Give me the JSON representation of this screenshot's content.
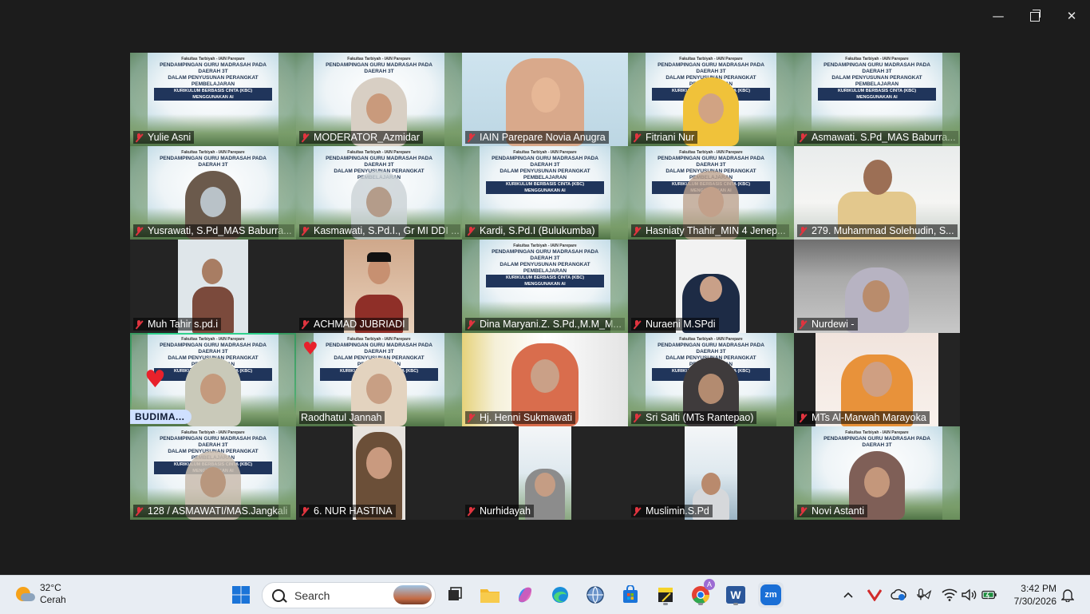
{
  "window": {
    "controls": {
      "minimize": "—",
      "close": "✕"
    }
  },
  "banner": {
    "line1": "Fakultas Tarbiyah - IAIN Parepare",
    "line2": "PENDAMPINGAN GURU MADRASAH PADA DAERAH 3T",
    "line3": "DALAM PENYUSUNAN PERANGKAT PEMBELAJARAN",
    "line4": "KURIKULUM BERBASIS CINTA (KBC) MENGGUNAKAN AI"
  },
  "participants": [
    {
      "name": "Yulie Asni",
      "muted": true
    },
    {
      "name": "MODERATOR_Azmidar",
      "muted": true
    },
    {
      "name": "IAIN Parepare Novia Anugra",
      "muted": true
    },
    {
      "name": "Fitriani Nur",
      "muted": true
    },
    {
      "name": "Asmawati. S.Pd_MAS Baburra...",
      "muted": true
    },
    {
      "name": "Yusrawati, S.Pd_MAS Baburra...",
      "muted": true
    },
    {
      "name": "Kasmawati, S.Pd.I., Gr MI DDI ...",
      "muted": true
    },
    {
      "name": "Kardi, S.Pd.I (Bulukumba)",
      "muted": true
    },
    {
      "name": "Hasniaty Thahir_MIN 4 Jenep...",
      "muted": true
    },
    {
      "name": "279. Muhammad Solehudin, S...",
      "muted": true
    },
    {
      "name": "Muh Tahir s.pd.i",
      "muted": true
    },
    {
      "name": "ACHMAD JUBRIADI",
      "muted": true
    },
    {
      "name": "Dina Maryani.Z. S.Pd.,M.M_M...",
      "muted": true
    },
    {
      "name": "Nuraeni M.SPdi",
      "muted": true
    },
    {
      "name": "Nurdewi -",
      "muted": true
    },
    {
      "name": "BUDIMA...",
      "muted": false
    },
    {
      "name": "Raodhatul Jannah",
      "muted": false
    },
    {
      "name": "Hj. Henni Sukmawati",
      "muted": true
    },
    {
      "name": "Sri Salti (MTs Rantepao)",
      "muted": true
    },
    {
      "name": "MTs Al-Marwah Marayoka",
      "muted": true
    },
    {
      "name": "128 / ASMAWATI/MAS.Jangkali",
      "muted": true
    },
    {
      "name": "6. NUR HASTINA",
      "muted": true
    },
    {
      "name": "Nurhidayah",
      "muted": true
    },
    {
      "name": "Muslimin.S.Pd",
      "muted": true
    },
    {
      "name": "Novi Astanti",
      "muted": true
    }
  ],
  "reactions": {
    "heart": "♥"
  },
  "taskbar": {
    "weather": {
      "temp": "32°C",
      "condition": "Cerah"
    },
    "search_placeholder": "Search",
    "time": "3:42 PM",
    "date": "7/30/2026",
    "chrome_badge": "A",
    "zoom_label": "zm",
    "word_label": "W"
  },
  "colors": {
    "active_speaker": "#2fd18d",
    "muted_mic": "#e0343f",
    "taskbar": "#e8edf3"
  }
}
